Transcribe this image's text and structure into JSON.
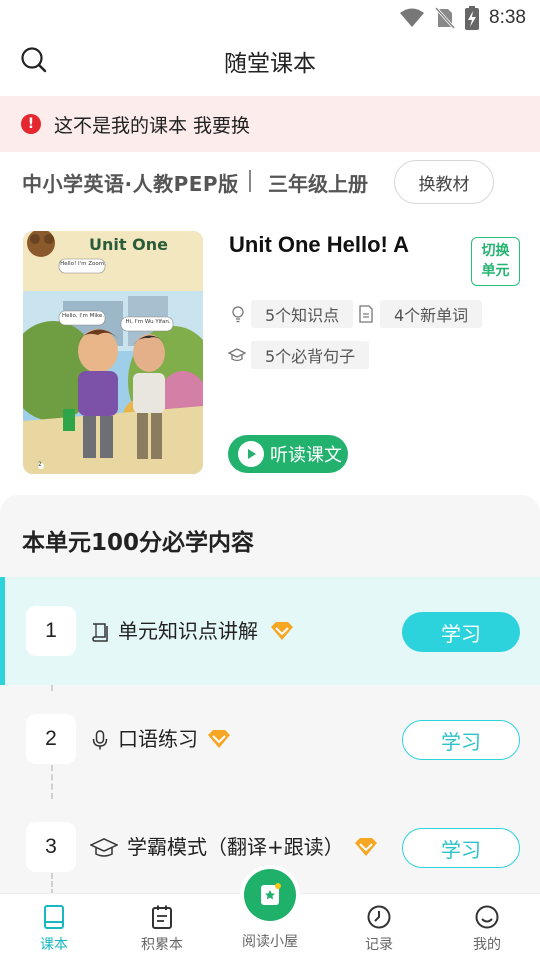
{
  "status_bar": {
    "time": "8:38"
  },
  "header": {
    "title": "随堂课本"
  },
  "alert": {
    "text": "这不是我的课本 我要换"
  },
  "book": {
    "name": "中小学英语·人教PEP版",
    "grade": "三年级上册",
    "change_label": "换教材"
  },
  "unit": {
    "title": "Unit One Hello! A",
    "switch_label_1": "切换",
    "switch_label_2": "单元",
    "cover": {
      "title": "Unit One",
      "bubble_1": "Hello! I'm Zoom.",
      "bubble_2": "Hello, I'm Mike.",
      "bubble_3": "Hi, I'm Wu Yifan.",
      "page_number": "2"
    },
    "tags": {
      "knowledge": "5个知识点",
      "words": "4个新单词",
      "sentences": "5个必背句子"
    },
    "listen_label": "听读课文"
  },
  "section": {
    "title": "本单元100分必学内容",
    "items": [
      {
        "number": "1",
        "label": "单元知识点讲解",
        "button": "学习",
        "icon": "book-icon"
      },
      {
        "number": "2",
        "label": "口语练习",
        "button": "学习",
        "icon": "microphone-icon"
      },
      {
        "number": "3",
        "label": "学霸模式（翻译+跟读）",
        "button": "学习",
        "icon": "graduation-cap-icon"
      }
    ]
  },
  "bottom_nav": {
    "items": [
      {
        "label": "课本",
        "icon": "textbook-icon"
      },
      {
        "label": "积累本",
        "icon": "notebook-icon"
      },
      {
        "label": "阅读小屋",
        "icon": "reading-house-icon"
      },
      {
        "label": "记录",
        "icon": "record-clock-icon"
      },
      {
        "label": "我的",
        "icon": "profile-smile-icon"
      }
    ]
  },
  "colors": {
    "accent": "#2cd3dc",
    "green": "#22b26e",
    "alert_bg": "#fdecec",
    "alert_icon": "#e5272f"
  }
}
